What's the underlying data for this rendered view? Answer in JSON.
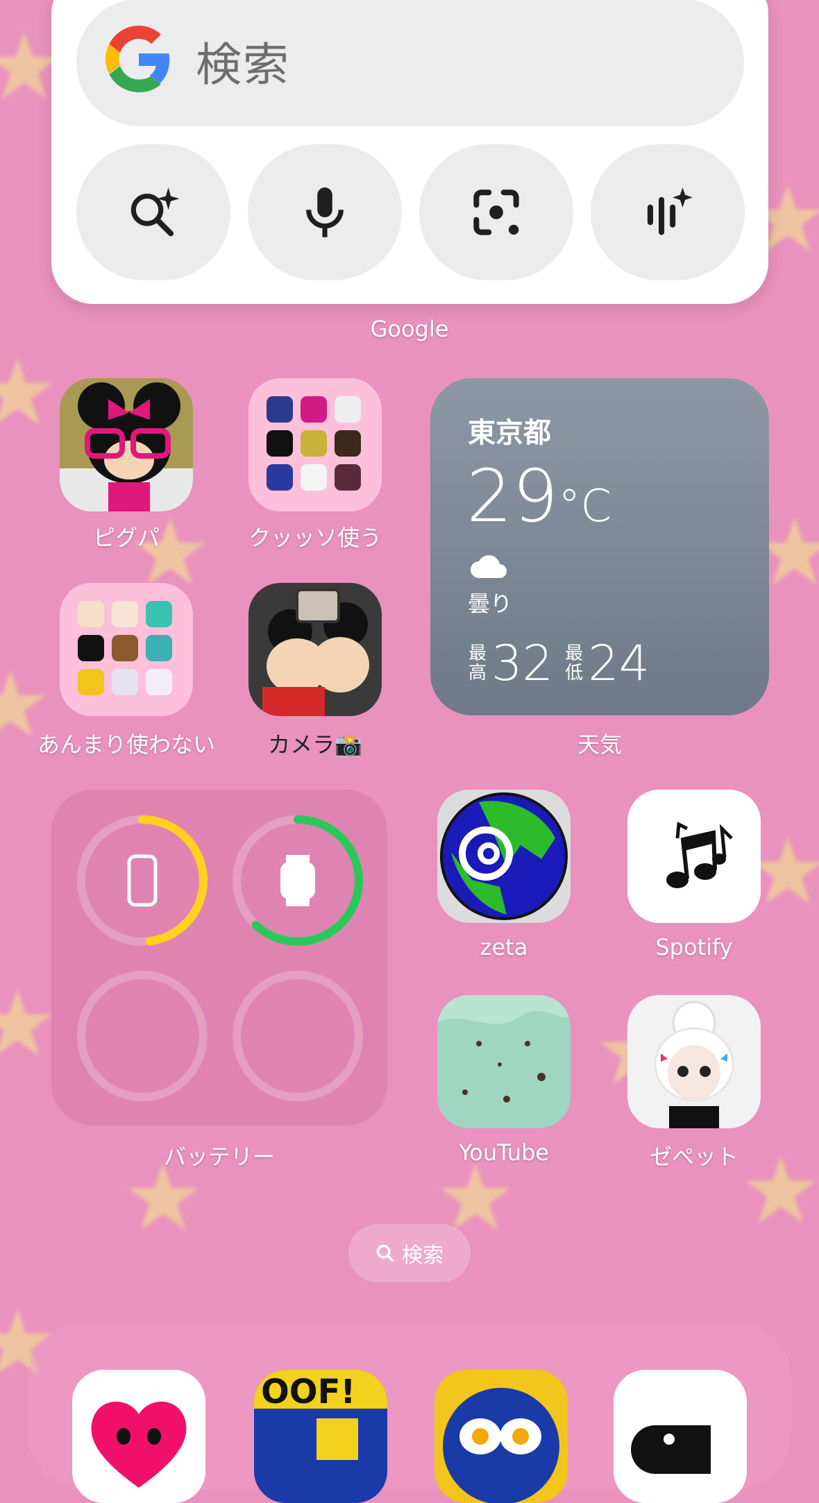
{
  "google_widget": {
    "search_placeholder": "検索",
    "label": "Google",
    "buttons": [
      "ai-search-icon",
      "mic-icon",
      "lens-camera-icon",
      "sound-search-icon"
    ]
  },
  "apps": {
    "pigupa": "ピグパ",
    "folder1": "クッッソ使う",
    "folder2": "あんまり使わない",
    "camera": "カメラ📸",
    "zeta": "zeta",
    "spotify": "Spotify",
    "youtube": "YouTube",
    "zepeto": "ゼペット"
  },
  "weather": {
    "city": "東京都",
    "temp": "29",
    "unit": "°C",
    "condition": "曇り",
    "high_label_1": "最",
    "high_label_2": "高",
    "high": "32",
    "low_label_1": "最",
    "low_label_2": "低",
    "low": "24",
    "label": "天気"
  },
  "battery": {
    "label": "バッテリー",
    "phone_level": 0.48,
    "watch_level": 0.62,
    "phone_color": "#ffd21f",
    "watch_color": "#2ac85a"
  },
  "home_search": "検索",
  "colors": {
    "background": "#e992bd",
    "star": "#f4ee8a"
  }
}
